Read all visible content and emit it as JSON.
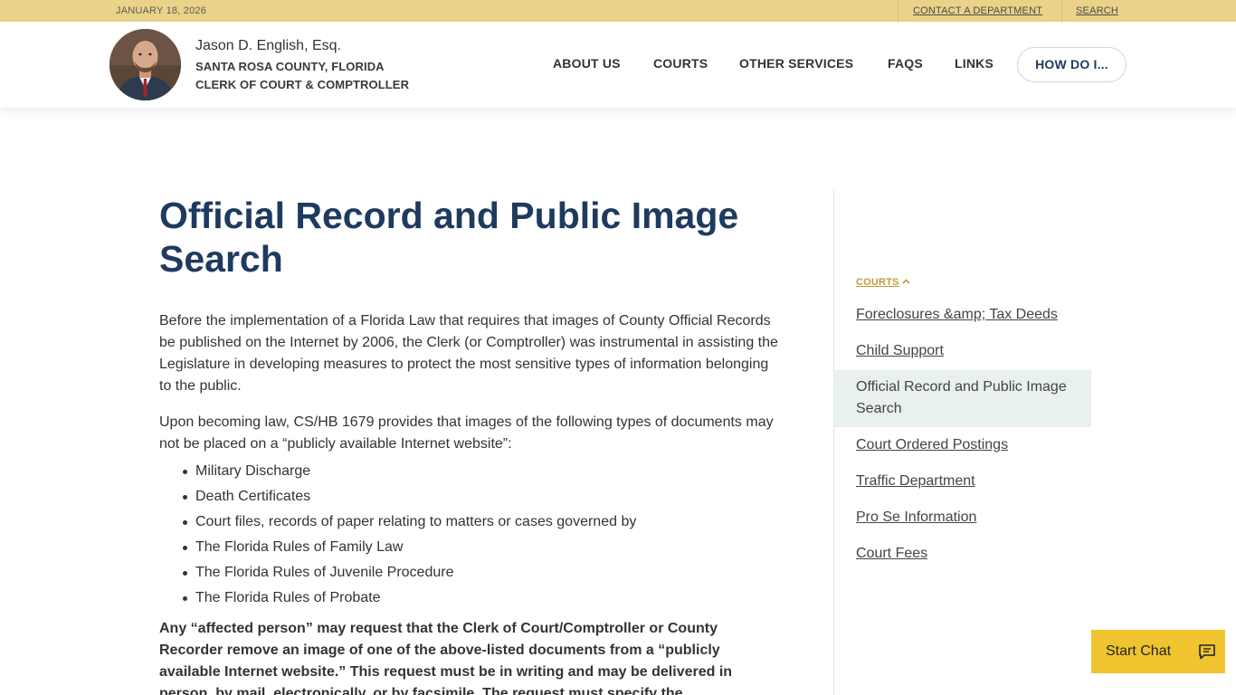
{
  "topbar": {
    "date": "JANUARY 18, 2026",
    "links": [
      {
        "label": "CONTACT A DEPARTMENT"
      },
      {
        "label": "SEARCH"
      }
    ]
  },
  "header": {
    "official_name": "Jason D. English, Esq.",
    "county": "SANTA ROSA COUNTY, FLORIDA",
    "office": "CLERK OF COURT & COMPTROLLER",
    "nav": [
      {
        "label": "ABOUT US"
      },
      {
        "label": "COURTS"
      },
      {
        "label": "OTHER SERVICES"
      },
      {
        "label": "FAQS"
      },
      {
        "label": "LINKS"
      }
    ],
    "how_do_i": "HOW DO I..."
  },
  "main": {
    "title": "Official Record and Public Image Search",
    "para1": "Before the implementation of a Florida Law that requires that images of County Official Records be published on the Internet by 2006, the Clerk (or Comptroller) was instrumental in assisting the Legislature in developing measures to protect the most sensitive types of information belonging to the public.",
    "para2": "Upon becoming law, CS/HB 1679 provides that images of the following types of documents may not be placed on a “publicly available Internet website”:",
    "bullets": [
      "Military Discharge",
      "Death Certificates",
      "Court files, records of paper relating to matters or cases governed by",
      "The Florida Rules of Family Law",
      "The Florida Rules of Juvenile Procedure",
      "The Florida Rules of Probate"
    ],
    "para3": "Any “affected person” may request that the Clerk of Court/Comptroller or County Recorder remove an image of one of the above-listed documents from a “publicly available Internet website.” This request must be in writing and may be delivered in person, by mail, electronically, or by facsimile. The request must specify the"
  },
  "sidebar": {
    "heading": "COURTS",
    "items": [
      {
        "label": "Foreclosures &amp; Tax Deeds"
      },
      {
        "label": "Child Support"
      },
      {
        "label": "Official Record and Public Image Search"
      },
      {
        "label": "Court Ordered Postings"
      },
      {
        "label": "Traffic Department"
      },
      {
        "label": "Pro Se Information"
      },
      {
        "label": "Court Fees"
      }
    ],
    "active_index": 2
  },
  "chat": {
    "label": "Start Chat",
    "icon": "chat-bubble-icon"
  },
  "colors": {
    "topbar": "#ead389",
    "title": "#1f3a5f",
    "accent_gold": "#c39b3f",
    "chat": "#f0c42e",
    "active_bg": "#e9f0f0"
  }
}
